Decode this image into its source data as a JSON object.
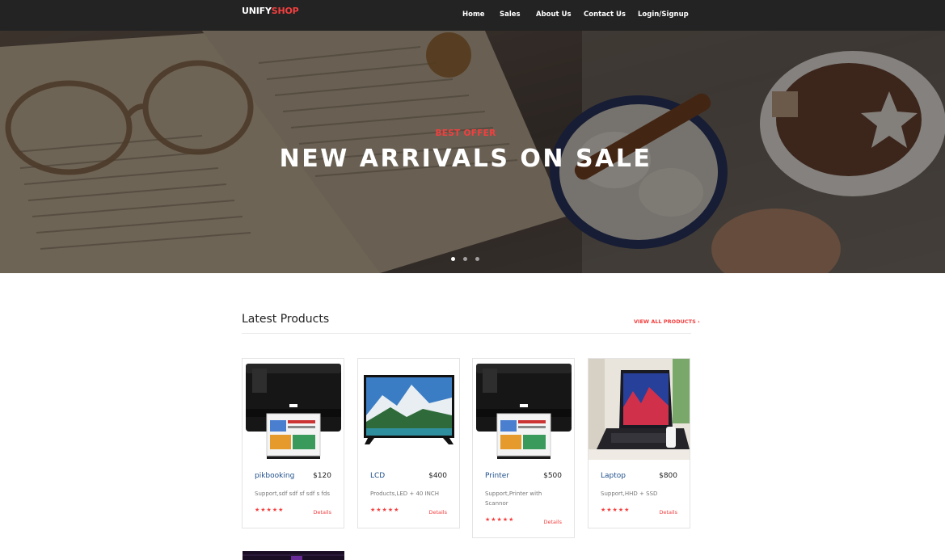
{
  "nav": {
    "logo_primary": "UNIFY",
    "logo_accent": "SHOP",
    "links": [
      "Home",
      "Sales",
      "About Us",
      "Contact Us",
      "Login/Signup"
    ]
  },
  "hero": {
    "subtitle": "BEST OFFER",
    "title": "NEW ARRIVALS ON SALE",
    "slide_count": 3,
    "active_slide": 1
  },
  "section": {
    "title": "Latest Products",
    "view_all": "VIEW ALL PRODUCTS ›"
  },
  "products": [
    {
      "name": "pikbooking",
      "price": "$120",
      "desc": "Support,sdf sdf sf sdf s fds",
      "stars": "★★★★★",
      "details": "Details",
      "image": "printer-icon"
    },
    {
      "name": "LCD",
      "price": "$400",
      "desc": "Products,LED + 40 INCH",
      "stars": "★★★★★",
      "details": "Details",
      "image": "tv-icon"
    },
    {
      "name": "Printer",
      "price": "$500",
      "desc": "Support,Printer with Scannor",
      "stars": "★★★★★",
      "details": "Details",
      "image": "printer-icon"
    },
    {
      "name": "Laptop",
      "price": "$800",
      "desc": "Support,HHD + SSD",
      "stars": "★★★★★",
      "details": "Details",
      "image": "laptop-icon"
    }
  ],
  "colors": {
    "accent": "#f33f3f",
    "navbar": "#232323",
    "product_name": "#1f4f8b"
  }
}
